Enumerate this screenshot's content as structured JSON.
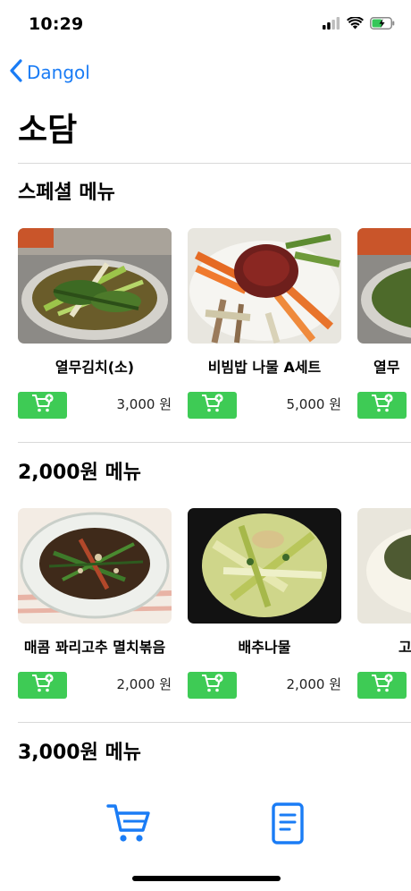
{
  "status_bar": {
    "time": "10:29",
    "icons": [
      "cellular-signal-icon",
      "wifi-icon",
      "battery-charging-icon"
    ]
  },
  "nav": {
    "back_label": "Dangol",
    "back_icon": "chevron-left-icon"
  },
  "page": {
    "title": "소담"
  },
  "sections": [
    {
      "title": "스페셜 메뉴",
      "items": [
        {
          "name": "열무김치(소)",
          "price": "3,000 원"
        },
        {
          "name": "비빔밥 나물 A세트",
          "price": "5,000 원"
        },
        {
          "name": "열무",
          "price": ""
        }
      ]
    },
    {
      "title": "2,000원 메뉴",
      "items": [
        {
          "name": "매콤 꽈리고추 멸치볶음",
          "price": "2,000 원"
        },
        {
          "name": "배추나물",
          "price": "2,000 원"
        },
        {
          "name": "고",
          "price": ""
        }
      ]
    },
    {
      "title": "3,000원 메뉴",
      "items": []
    }
  ],
  "tab_bar": {
    "items": [
      "cart-icon",
      "order-list-icon"
    ]
  },
  "colors": {
    "accent": "#1a7cf5",
    "cart_button": "#3ecb55",
    "divider": "#d9d9d9"
  }
}
